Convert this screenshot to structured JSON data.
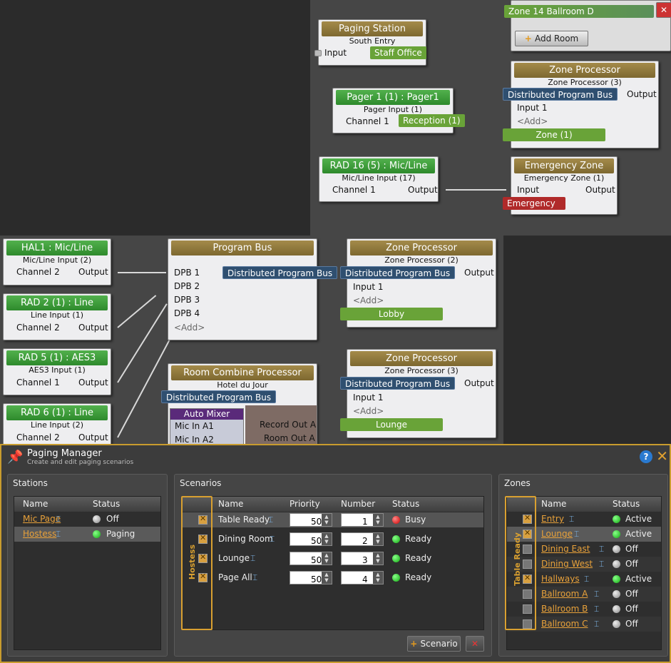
{
  "top": {
    "paging_station": {
      "title": "Paging Station",
      "sub": "South Entry",
      "input": "Input",
      "tag": "Staff Office"
    },
    "zone14": {
      "tag": "Zone 14 Ballroom D",
      "add_room": "Add Room"
    },
    "pager1": {
      "title": "Pager 1 (1) : Pager1",
      "sub": "Pager Input (1)",
      "channel": "Channel 1",
      "tag": "Reception (1)"
    },
    "zp3": {
      "title": "Zone Processor",
      "sub": "Zone Processor (3)",
      "bus": "Distributed Program Bus",
      "output": "Output",
      "input1": "Input 1",
      "add": "<Add>",
      "tag": "Zone (1)"
    },
    "rad16": {
      "title": "RAD 16 (5) : Mic/Line",
      "sub": "Mic/Line Input (17)",
      "channel": "Channel 1",
      "output": "Output"
    },
    "emergency": {
      "title": "Emergency Zone",
      "sub": "Emergency Zone (1)",
      "input": "Input",
      "output": "Output",
      "tag": "Emergency"
    }
  },
  "mid": {
    "hal1": {
      "title": "HAL1 : Mic/Line",
      "sub": "Mic/Line Input (2)",
      "channel": "Channel 2",
      "output": "Output"
    },
    "rad2": {
      "title": "RAD 2 (1) : Line",
      "sub": "Line Input (1)",
      "channel": "Channel 2",
      "output": "Output"
    },
    "rad5": {
      "title": "RAD 5 (1) : AES3",
      "sub": "AES3 Input (1)",
      "channel": "Channel 1",
      "output": "Output"
    },
    "rad6": {
      "title": "RAD 6 (1) : Line",
      "sub": "Line Input (2)",
      "channel": "Channel 2",
      "output": "Output"
    },
    "program_bus": {
      "title": "Program Bus",
      "bus": "Distributed Program Bus",
      "dpb": [
        "DPB 1",
        "DPB 2",
        "DPB 3",
        "DPB 4"
      ],
      "add": "<Add>"
    },
    "zp2": {
      "title": "Zone Processor",
      "sub": "Zone Processor (2)",
      "bus": "Distributed Program Bus",
      "output": "Output",
      "input1": "Input 1",
      "add": "<Add>",
      "tag": "Lobby"
    },
    "zp3b": {
      "title": "Zone Processor",
      "sub": "Zone Processor (3)",
      "bus": "Distributed Program Bus",
      "output": "Output",
      "input1": "Input 1",
      "add": "<Add>",
      "tag": "Lounge"
    },
    "rcp": {
      "title": "Room Combine Processor",
      "sub": "Hotel du Jour",
      "bus": "Distributed Program Bus",
      "automixer": "Auto Mixer",
      "mic1": "Mic In A1",
      "mic2": "Mic In A2",
      "rec": "Record Out A",
      "room": "Room Out A"
    }
  },
  "pm": {
    "title": "Paging Manager",
    "subtitle": "Create and edit paging scenarios",
    "stations": {
      "title": "Stations",
      "col_name": "Name",
      "col_status": "Status",
      "rows": [
        {
          "name": "Mic Page",
          "status": "Off",
          "dot": "grey"
        },
        {
          "name": "Hostess",
          "status": "Paging",
          "dot": "green"
        }
      ]
    },
    "scenarios": {
      "title": "Scenarios",
      "bracket_label": "Hostess",
      "col_name": "Name",
      "col_priority": "Priority",
      "col_number": "Number",
      "col_status": "Status",
      "rows": [
        {
          "name": "Table Ready",
          "priority": "50",
          "number": "1",
          "status": "Busy",
          "dot": "red"
        },
        {
          "name": "Dining Room",
          "priority": "50",
          "number": "2",
          "status": "Ready",
          "dot": "green"
        },
        {
          "name": "Lounge",
          "priority": "50",
          "number": "3",
          "status": "Ready",
          "dot": "green"
        },
        {
          "name": "Page All",
          "priority": "50",
          "number": "4",
          "status": "Ready",
          "dot": "green"
        }
      ],
      "scenario_button": "Scenario"
    },
    "zones": {
      "title": "Zones",
      "bracket_label": "Table Ready",
      "col_name": "Name",
      "col_status": "Status",
      "rows": [
        {
          "name": "Entry",
          "status": "Active",
          "dot": "green",
          "checked": true
        },
        {
          "name": "Lounge",
          "status": "Active",
          "dot": "green",
          "checked": true
        },
        {
          "name": "Dining East",
          "status": "Off",
          "dot": "grey",
          "checked": false
        },
        {
          "name": "Dining West",
          "status": "Off",
          "dot": "grey",
          "checked": false
        },
        {
          "name": "Hallways",
          "status": "Active",
          "dot": "green",
          "checked": true
        },
        {
          "name": "Ballroom A",
          "status": "Off",
          "dot": "grey",
          "checked": false
        },
        {
          "name": "Ballroom B",
          "status": "Off",
          "dot": "grey",
          "checked": false
        },
        {
          "name": "Ballroom C",
          "status": "Off",
          "dot": "grey",
          "checked": false
        }
      ]
    }
  }
}
